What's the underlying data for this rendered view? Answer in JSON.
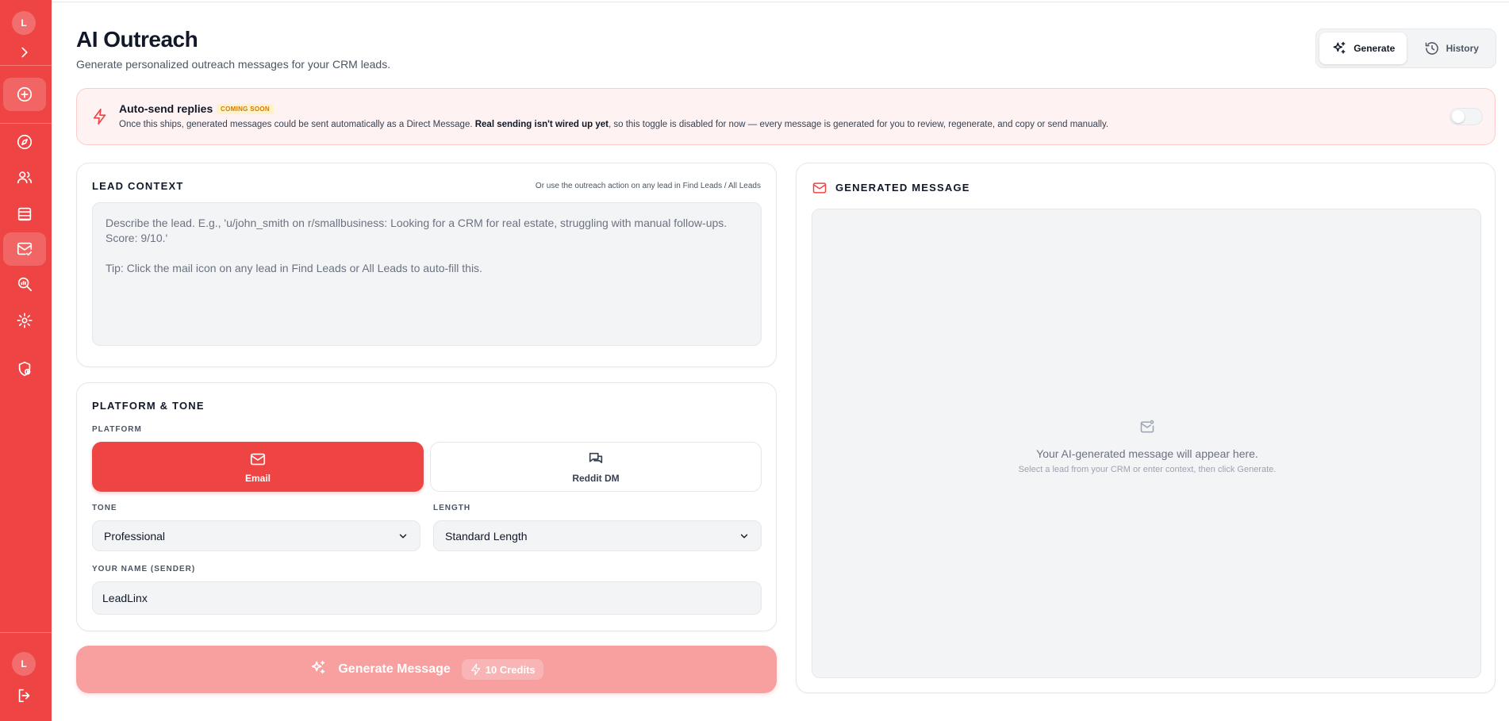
{
  "sidebar": {
    "user_initial": "L",
    "footer_initial": "L",
    "items": [
      {
        "icon": "chevron-right-icon"
      },
      {
        "icon": "plus-circle-icon"
      },
      {
        "icon": "compass-icon"
      },
      {
        "icon": "users-icon"
      },
      {
        "icon": "table-icon"
      },
      {
        "icon": "mail-check-icon"
      },
      {
        "icon": "search-analytics-icon"
      },
      {
        "icon": "gear-icon"
      },
      {
        "icon": "shield-icon"
      },
      {
        "icon": "logout-icon"
      }
    ],
    "active_item": "mail-check-icon"
  },
  "header": {
    "title": "AI Outreach",
    "subtitle": "Generate personalized outreach messages for your CRM leads.",
    "tabs": [
      {
        "label": "Generate",
        "icon": "sparkles-icon",
        "active": true
      },
      {
        "label": "History",
        "icon": "history-icon",
        "active": false
      }
    ]
  },
  "banner": {
    "title": "Auto-send replies",
    "badge": "COMING SOON",
    "desc_start": "Once this ships, generated messages could be sent automatically as a Direct Message. ",
    "desc_bold": "Real sending isn't wired up yet",
    "desc_end": ", so this toggle is disabled for now — every message is generated for you to review, regenerate, and copy or send manually.",
    "toggle_enabled": false
  },
  "lead_context": {
    "title": "LEAD CONTEXT",
    "hint": "Or use the outreach action on any lead in Find Leads / All Leads",
    "placeholder": "Describe the lead. E.g., 'u/john_smith on r/smallbusiness: Looking for a CRM for real estate, struggling with manual follow-ups. Score: 9/10.'\n\nTip: Click the mail icon on any lead in Find Leads or All Leads to auto-fill this.",
    "value": ""
  },
  "platform_tone": {
    "title": "PLATFORM & TONE",
    "platform_label": "PLATFORM",
    "platforms": [
      {
        "label": "Email",
        "icon": "mail-icon",
        "selected": true
      },
      {
        "label": "Reddit DM",
        "icon": "chat-bubbles-icon",
        "selected": false
      }
    ],
    "tone_label": "TONE",
    "tone_value": "Professional",
    "length_label": "LENGTH",
    "length_value": "Standard Length",
    "sender_label": "YOUR NAME (SENDER)",
    "sender_value": "LeadLinx"
  },
  "generate_button": {
    "label": "Generate Message",
    "credits": "10 Credits",
    "disabled": true
  },
  "generated_message": {
    "title": "GENERATED MESSAGE",
    "empty_title": "Your AI-generated message will appear here.",
    "empty_subtitle": "Select a lead from your CRM or enter context, then click Generate."
  },
  "colors": {
    "brand": "#ef4444",
    "brand_disabled": "#f8a0a0",
    "banner_bg": "#fef2f2",
    "badge_text": "#d97706",
    "badge_bg": "#fef3c7"
  }
}
